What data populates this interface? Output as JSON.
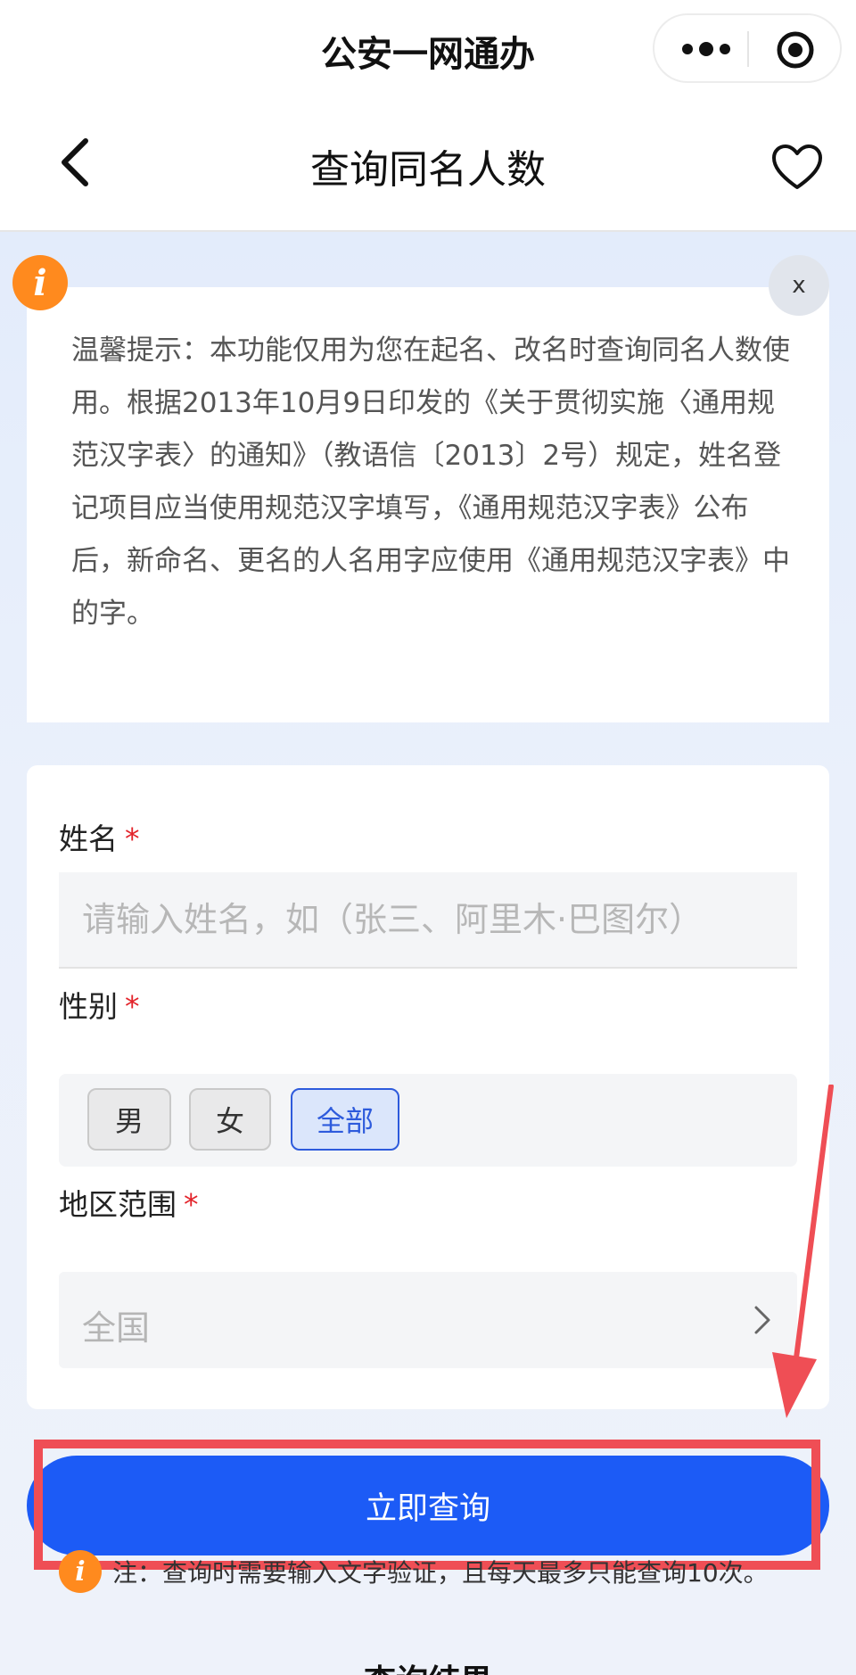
{
  "app": {
    "title": "公安一网通办"
  },
  "nav": {
    "title": "查询同名人数"
  },
  "notice": {
    "text": "温馨提示：本功能仅用为您在起名、改名时查询同名人数使用。根据2013年10月9日印发的《关于贯彻实施〈通用规范汉字表〉的通知》（教语信〔2013〕2号）规定，姓名登记项目应当使用规范汉字填写，《通用规范汉字表》公布后，新命名、更名的人名用字应使用《通用规范汉字表》中的字。",
    "close_label": "x"
  },
  "form": {
    "required_mark": "*",
    "name": {
      "label": "姓名",
      "placeholder": "请输入姓名，如（张三、阿里木·巴图尔）",
      "value": ""
    },
    "gender": {
      "label": "性别",
      "options": [
        "男",
        "女",
        "全部"
      ],
      "selected": "全部"
    },
    "region": {
      "label": "地区范围",
      "value": "全国"
    }
  },
  "submit": {
    "label": "立即查询"
  },
  "note": {
    "text": "注：查询时需要输入文字验证，且每天最多只能查询10次。"
  },
  "result": {
    "title": "查询结果"
  },
  "colors": {
    "primary": "#1c5bf6",
    "accent_orange": "#ff8a1e",
    "required_red": "#e3242b",
    "annotation_red": "#ef4e55"
  },
  "icons": {
    "more": "more-dots-icon",
    "target": "target-icon",
    "back": "chevron-left-icon",
    "favorite": "heart-icon",
    "info": "info-icon",
    "chevron": "chevron-right-icon"
  }
}
